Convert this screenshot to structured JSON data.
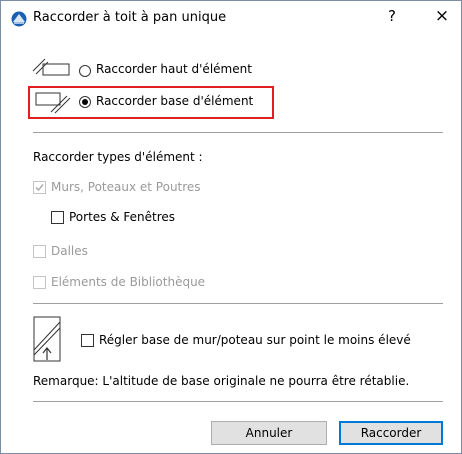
{
  "window": {
    "title": "Raccorder à toit à pan unique",
    "help_label": "?",
    "close_label": "×"
  },
  "options": {
    "top_label": "Raccorder haut d'élément",
    "bottom_label": "Raccorder base d'élément",
    "selected": "bottom"
  },
  "types": {
    "heading": "Raccorder types d'élément :",
    "walls_label": "Murs, Poteaux et Poutres",
    "doors_label": "Portes & Fenêtres",
    "slabs_label": "Dalles",
    "library_label": "Eléments de Bibliothèque"
  },
  "adjust": {
    "label": "Régler base de mur/poteau sur point le moins élevé"
  },
  "note": "Remarque: L'altitude de base originale ne pourra être rétablie.",
  "buttons": {
    "cancel": "Annuler",
    "ok": "Raccorder"
  },
  "colors": {
    "highlight": "#e02020",
    "accent": "#0078d7"
  }
}
